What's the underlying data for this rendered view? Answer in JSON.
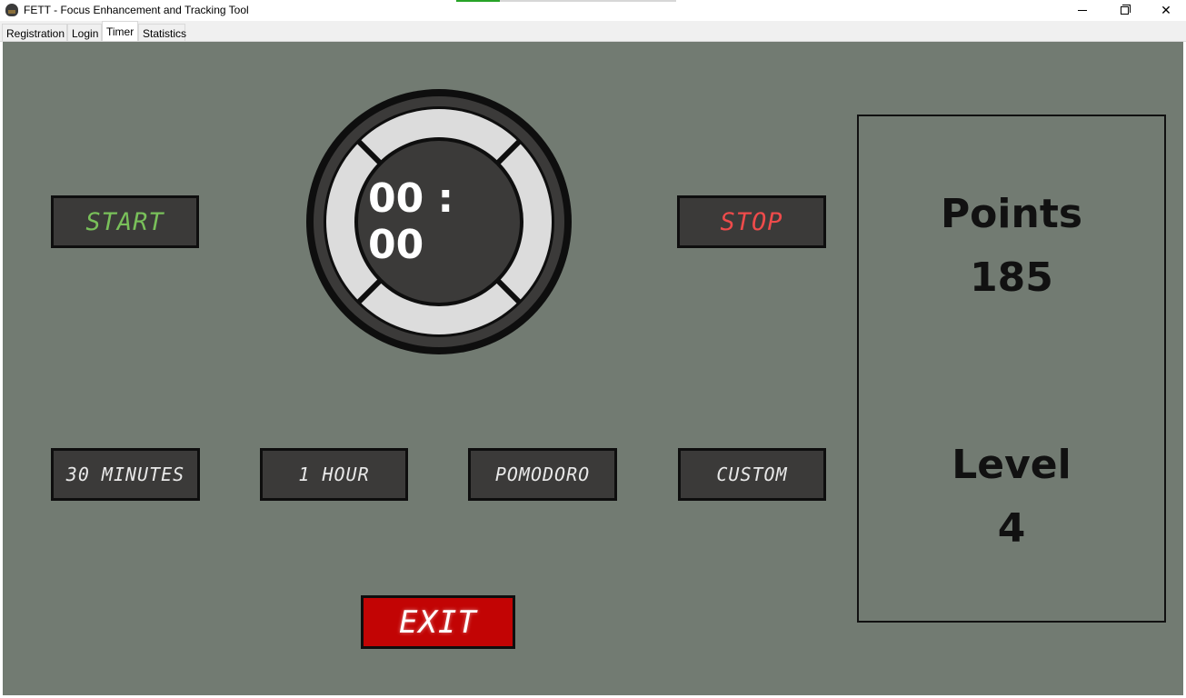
{
  "window": {
    "title": "FETT - Focus Enhancement and Tracking Tool",
    "controls": {
      "minimize_icon": "minimize-icon",
      "maximize_icon": "restore-icon",
      "close_icon": "close-icon",
      "close_label": "✕"
    }
  },
  "progress": {
    "fraction": 0.2
  },
  "tabs": [
    {
      "label": "Registration",
      "active": false
    },
    {
      "label": "Login",
      "active": false
    },
    {
      "label": "Timer",
      "active": true
    },
    {
      "label": "Statistics",
      "active": false
    }
  ],
  "timer": {
    "display": "00 : 00",
    "start_label": "START",
    "stop_label": "STOP",
    "presets": [
      "30 MINUTES",
      "1 HOUR",
      "POMODORO",
      "CUSTOM"
    ],
    "exit_label": "EXIT"
  },
  "stats": {
    "points_label": "Points",
    "points_value": "185",
    "level_label": "Level",
    "level_value": "4"
  },
  "colors": {
    "background": "#727b72",
    "button_bg": "#3b3a39",
    "start_text": "#79c05a",
    "stop_text": "#ee4b4b",
    "exit_bg": "#c20404"
  }
}
